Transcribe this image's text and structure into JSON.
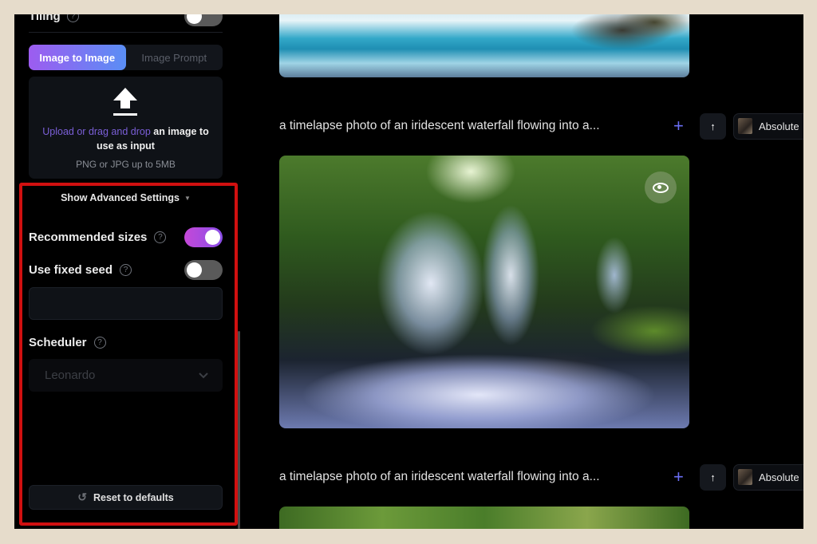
{
  "sidebar": {
    "tiling_label": "Tiling",
    "tiling_enabled": false,
    "mode_tabs": [
      {
        "label": "Image to Image",
        "active": true
      },
      {
        "label": "Image Prompt",
        "active": false
      }
    ],
    "upload": {
      "link_text": "Upload or drag and drop",
      "text": " an image to use as input",
      "hint": "PNG or JPG up to 5MB"
    },
    "advanced_toggle_label": "Show Advanced Settings",
    "recommended_sizes": {
      "label": "Recommended sizes",
      "enabled": true
    },
    "fixed_seed": {
      "label": "Use fixed seed",
      "enabled": false,
      "value": "",
      "placeholder": ""
    },
    "scheduler": {
      "label": "Scheduler",
      "selected": "Leonardo"
    },
    "reset_label": "Reset to defaults"
  },
  "generations": [
    {
      "prompt": "a timelapse photo of an iridescent waterfall flowing into a...",
      "model": "Absolute"
    },
    {
      "prompt": "a timelapse photo of an iridescent waterfall flowing into a...",
      "model": "Absolute"
    }
  ],
  "icons": {
    "upload": "upload-arrow",
    "help": "?",
    "caret": "▼",
    "chevron": "⌄",
    "reset": "↺",
    "plus": "+",
    "up": "🡅"
  },
  "colors": {
    "accent_gradient_start": "#9d5cf0",
    "accent_gradient_end": "#5a8ef5",
    "toggle_on": "#c548d8",
    "highlight_box": "#d11010",
    "link": "#7b5fd8"
  }
}
